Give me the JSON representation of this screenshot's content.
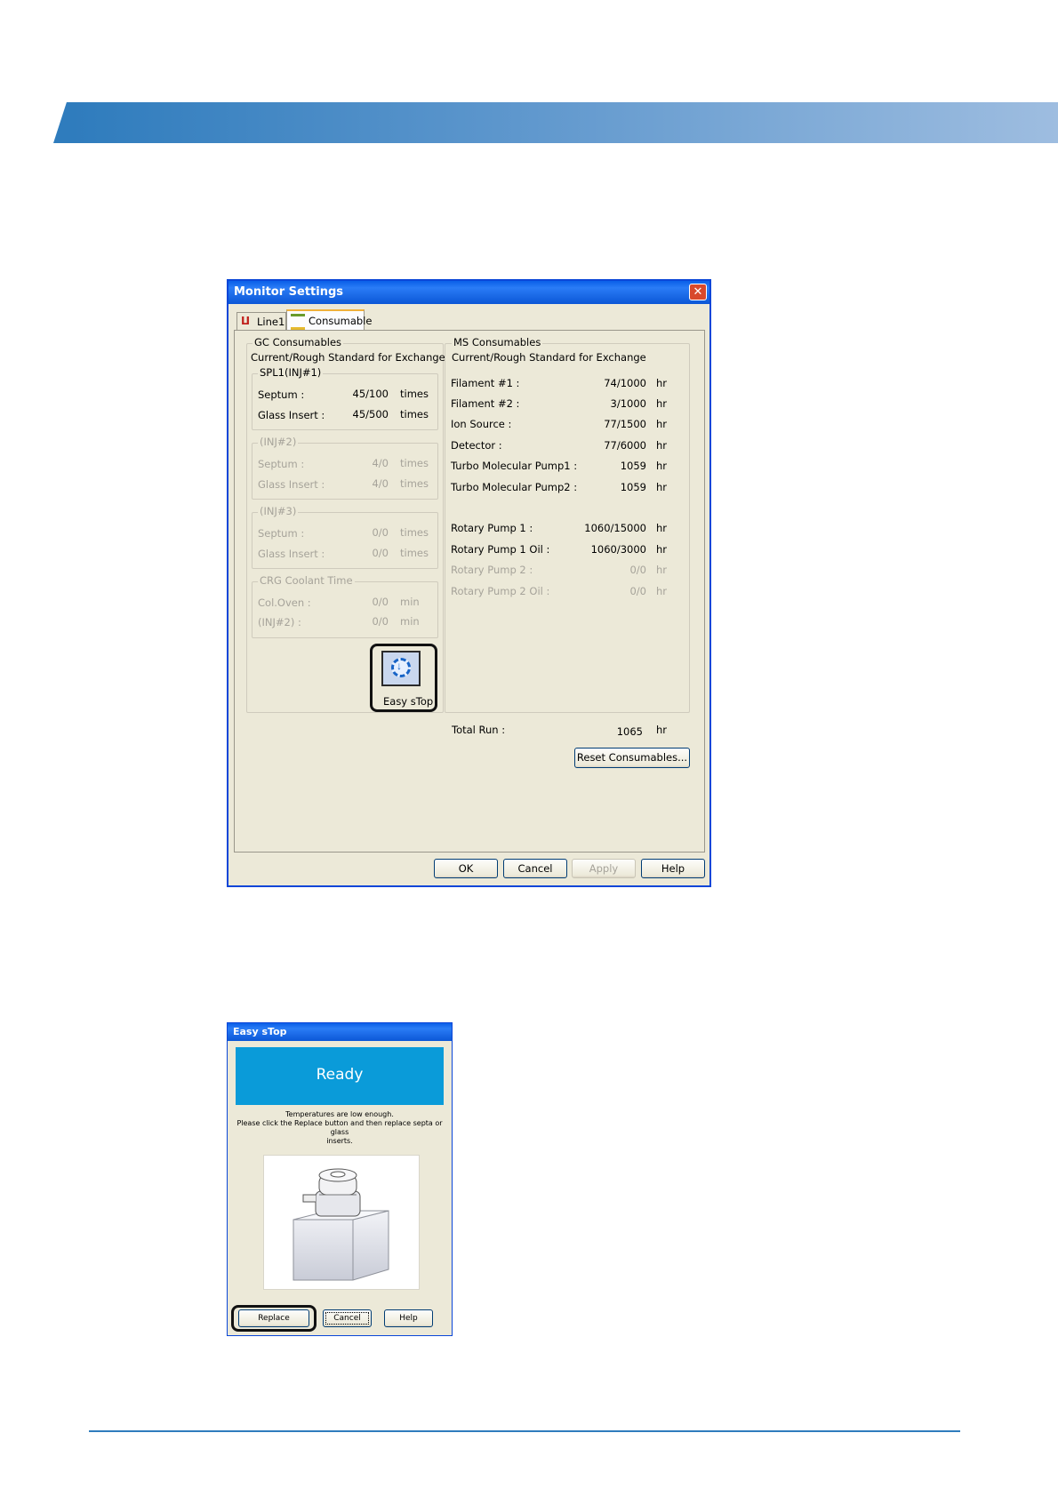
{
  "monitor": {
    "title": "Monitor Settings",
    "close": "✕",
    "tabs": [
      {
        "label": "Line1",
        "icon": "line-graph-icon"
      },
      {
        "label": "Consumable",
        "icon": "consumable-icon"
      }
    ],
    "gc": {
      "group_label": "GC Consumables",
      "subtitle": "Current/Rough Standard for Exchange",
      "spl1": {
        "label": "SPL1(INJ#1)",
        "rows": [
          {
            "name": "Septum :",
            "value": "45/100",
            "unit": "times"
          },
          {
            "name": "Glass Insert :",
            "value": "45/500",
            "unit": "times"
          }
        ]
      },
      "inj2": {
        "label": "(INJ#2)",
        "rows": [
          {
            "name": "Septum :",
            "value": "4/0",
            "unit": "times"
          },
          {
            "name": "Glass Insert :",
            "value": "4/0",
            "unit": "times"
          }
        ]
      },
      "inj3": {
        "label": "(INJ#3)",
        "rows": [
          {
            "name": "Septum :",
            "value": "0/0",
            "unit": "times"
          },
          {
            "name": "Glass Insert :",
            "value": "0/0",
            "unit": "times"
          }
        ]
      },
      "crg": {
        "label": "CRG Coolant Time",
        "rows": [
          {
            "name": "Col.Oven :",
            "value": "0/0",
            "unit": "min"
          },
          {
            "name": "(INJ#2) :",
            "value": "0/0",
            "unit": "min"
          }
        ]
      },
      "easy_stop_label": "Easy sTop"
    },
    "ms": {
      "group_label": "MS Consumables",
      "subtitle": "Current/Rough Standard for Exchange",
      "rows": [
        {
          "name": "Filament #1 :",
          "value": "74/1000",
          "unit": "hr"
        },
        {
          "name": "Filament #2 :",
          "value": "3/1000",
          "unit": "hr"
        },
        {
          "name": "Ion Source :",
          "value": "77/1500",
          "unit": "hr"
        },
        {
          "name": "Detector :",
          "value": "77/6000",
          "unit": "hr"
        },
        {
          "name": "Turbo Molecular Pump1 :",
          "value": "1059",
          "unit": "hr"
        },
        {
          "name": "Turbo Molecular Pump2 :",
          "value": "1059",
          "unit": "hr"
        },
        {
          "name": "Rotary Pump 1 :",
          "value": "1060/15000",
          "unit": "hr"
        },
        {
          "name": "Rotary Pump 1 Oil :",
          "value": "1060/3000",
          "unit": "hr"
        },
        {
          "name": "Rotary Pump 2 :",
          "value": "0/0",
          "unit": "hr"
        },
        {
          "name": "Rotary Pump 2 Oil :",
          "value": "0/0",
          "unit": "hr"
        }
      ]
    },
    "total_run": {
      "name": "Total Run :",
      "value": "1065",
      "unit": "hr"
    },
    "reset_button": "Reset Consumables...",
    "buttons": {
      "ok": "OK",
      "cancel": "Cancel",
      "apply": "Apply",
      "help": "Help"
    }
  },
  "easystop": {
    "title": "Easy sTop",
    "status": "Ready",
    "status_color": "#0a9bd9",
    "message_line1": "Temperatures are low enough.",
    "message_line2": "Please click the Replace button and then replace septa or glass",
    "message_line3": "inserts.",
    "buttons": {
      "replace": "Replace",
      "cancel": "Cancel",
      "help": "Help"
    }
  }
}
